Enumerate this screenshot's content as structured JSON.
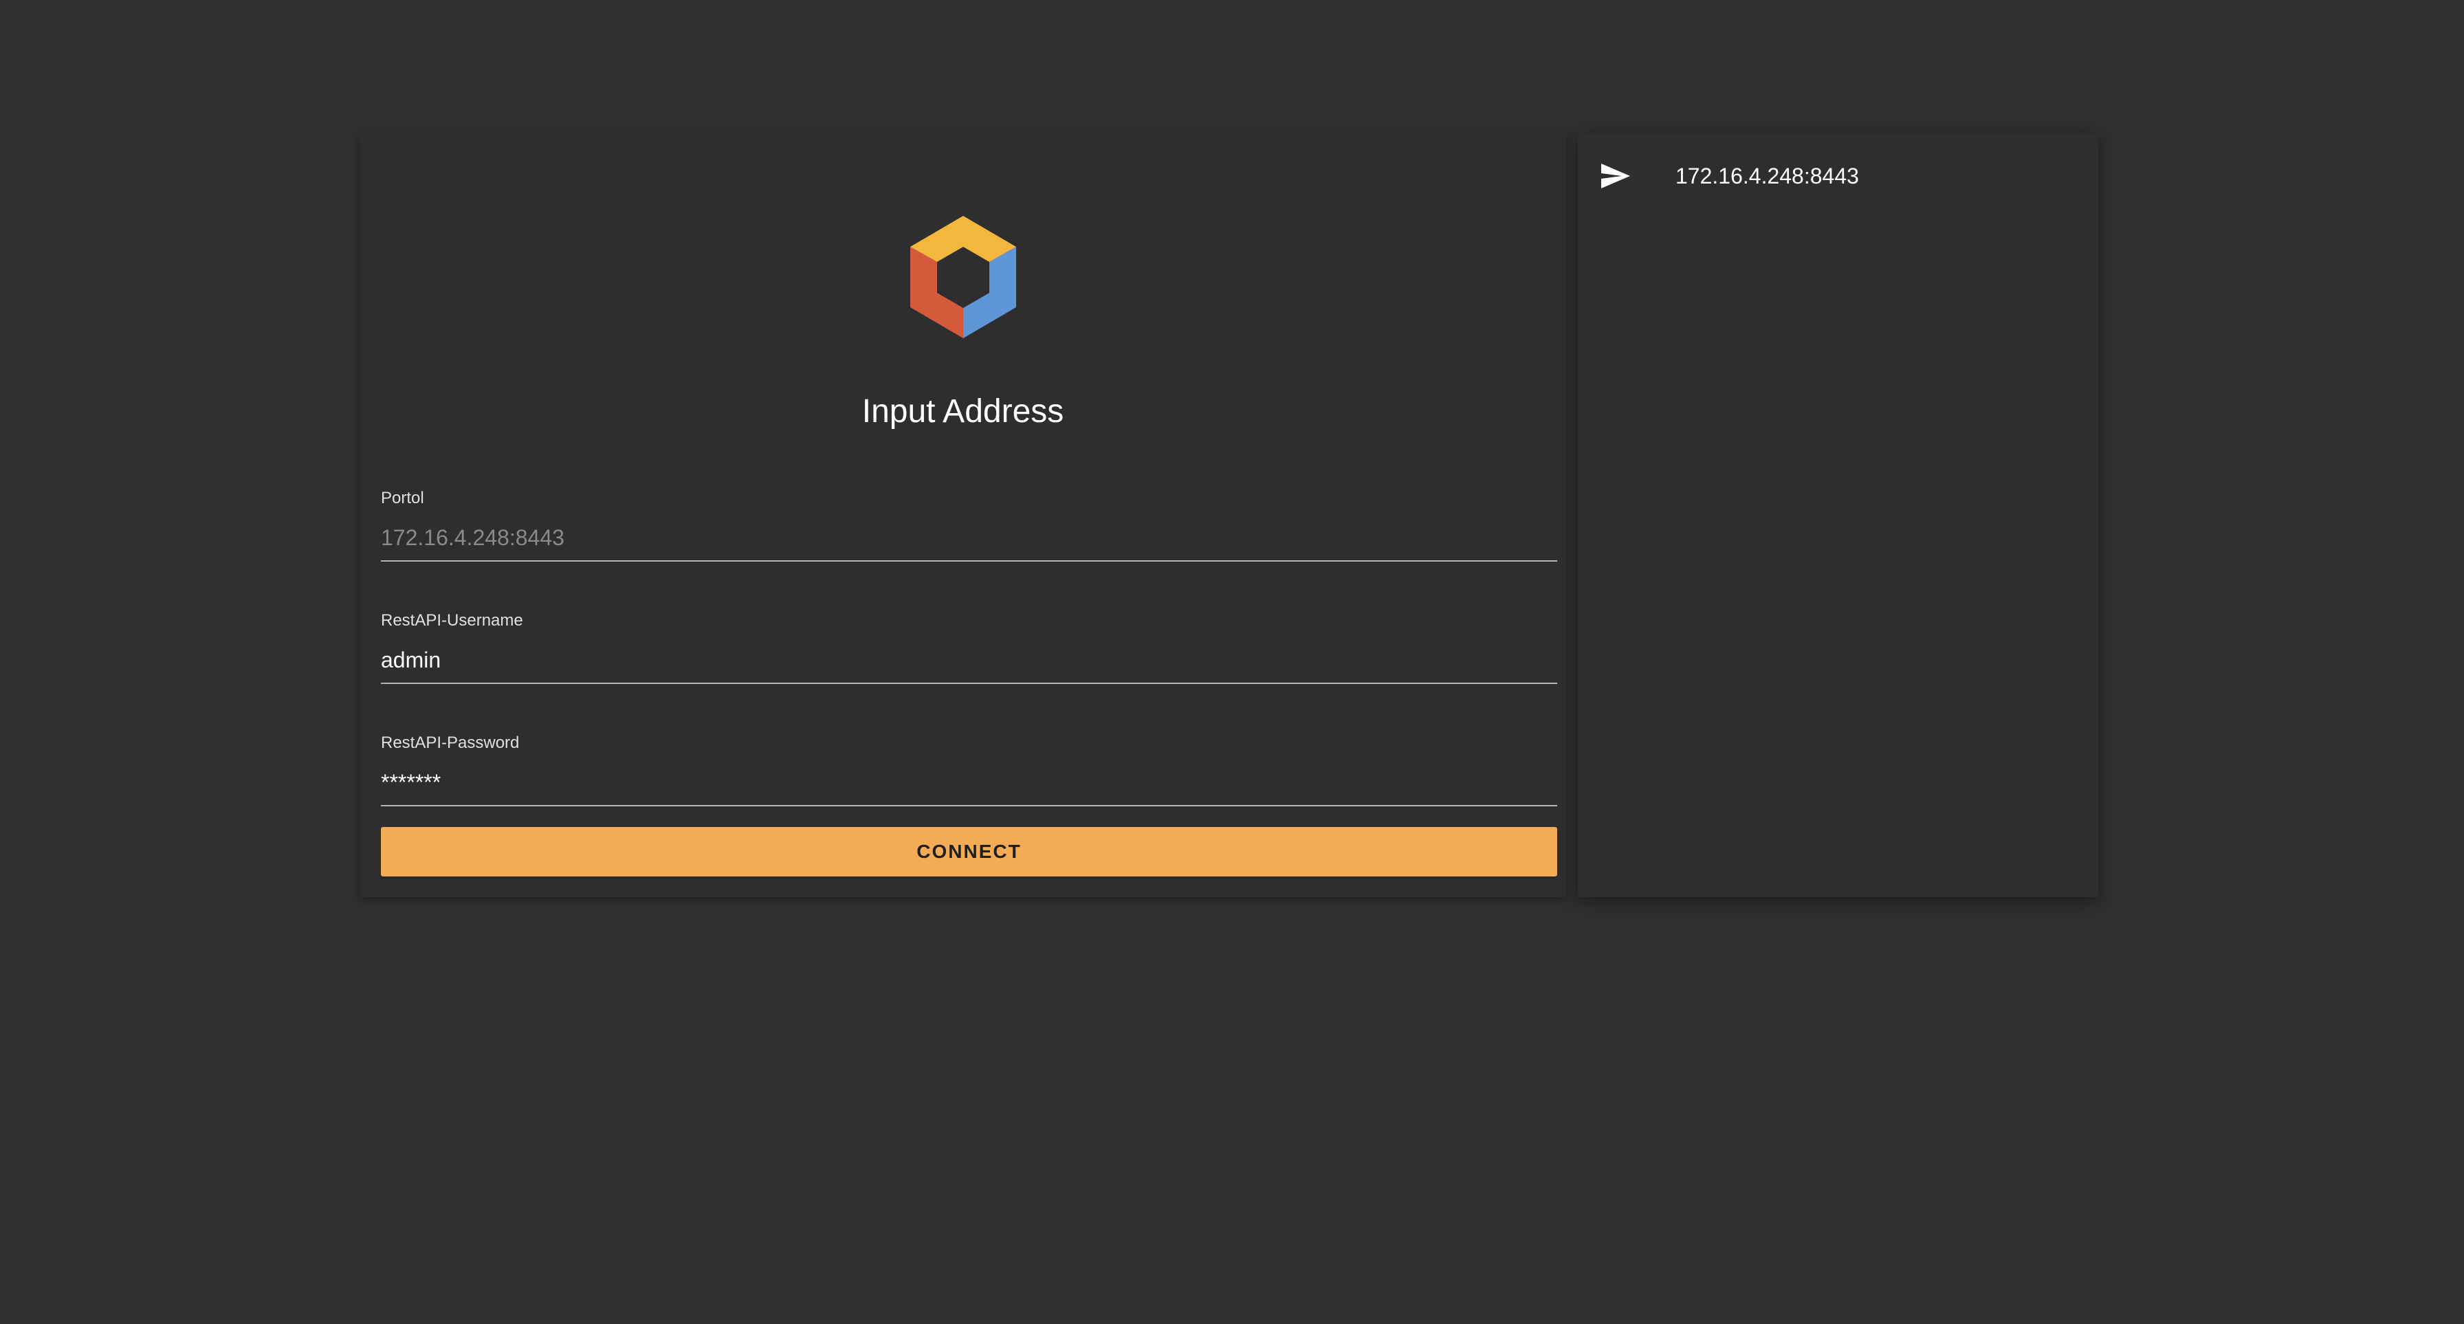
{
  "login": {
    "title": "Input Address",
    "logo_icon": "hexagon-logo-icon",
    "logo_colors": {
      "top": "#f2b73c",
      "left": "#d45a3b",
      "right": "#5e96d6"
    },
    "portal": {
      "label": "Portol",
      "value": "",
      "placeholder": "172.16.4.248:8443"
    },
    "username": {
      "label": "RestAPI-Username",
      "value": "admin"
    },
    "password": {
      "label": "RestAPI-Password",
      "value": "*******"
    },
    "connect_label": "CONNECT",
    "accent_color": "#f4ab55"
  },
  "history": {
    "items": [
      {
        "icon": "send-icon",
        "address": "172.16.4.248:8443"
      }
    ]
  }
}
